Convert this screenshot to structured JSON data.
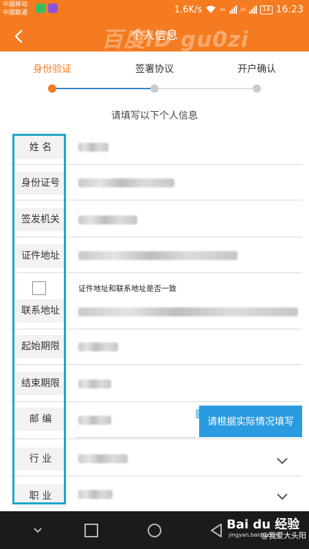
{
  "status_bar": {
    "carrier1": "中国移动",
    "carrier2": "中国联通",
    "speed": "1.6K/s",
    "net1": "4G",
    "net2": "2G",
    "battery": "14",
    "time": "16:23"
  },
  "header": {
    "title": "个人信息",
    "watermark": "百度ID gu0zi"
  },
  "steps": [
    {
      "label": "身份验证",
      "active": true
    },
    {
      "label": "签署协议",
      "active": false
    },
    {
      "label": "开户确认",
      "active": false
    }
  ],
  "hint": "请填写以下个人信息",
  "form": {
    "name_label": "姓    名",
    "id_label": "身份证号",
    "issuer_label": "签发机关",
    "id_address_label": "证件地址",
    "same_address_text": "证件地址和联系地址是否一致",
    "contact_address_label": "联系地址",
    "start_label": "起始期限",
    "end_label": "结束期限",
    "postcode_label": "邮    编",
    "industry_label": "行    业",
    "job_label": "职    业"
  },
  "tip_button": "请根据实际情况填写",
  "watermark_footer": {
    "brand": "Bai du 经验",
    "site": "jingyan.baidu.com",
    "user": "@我爱大头阳"
  },
  "colors": {
    "accent": "#f47b20",
    "step_progress": "#2f86d3",
    "highlight_box": "#1ba5c8",
    "tip": "#2a9be0"
  }
}
